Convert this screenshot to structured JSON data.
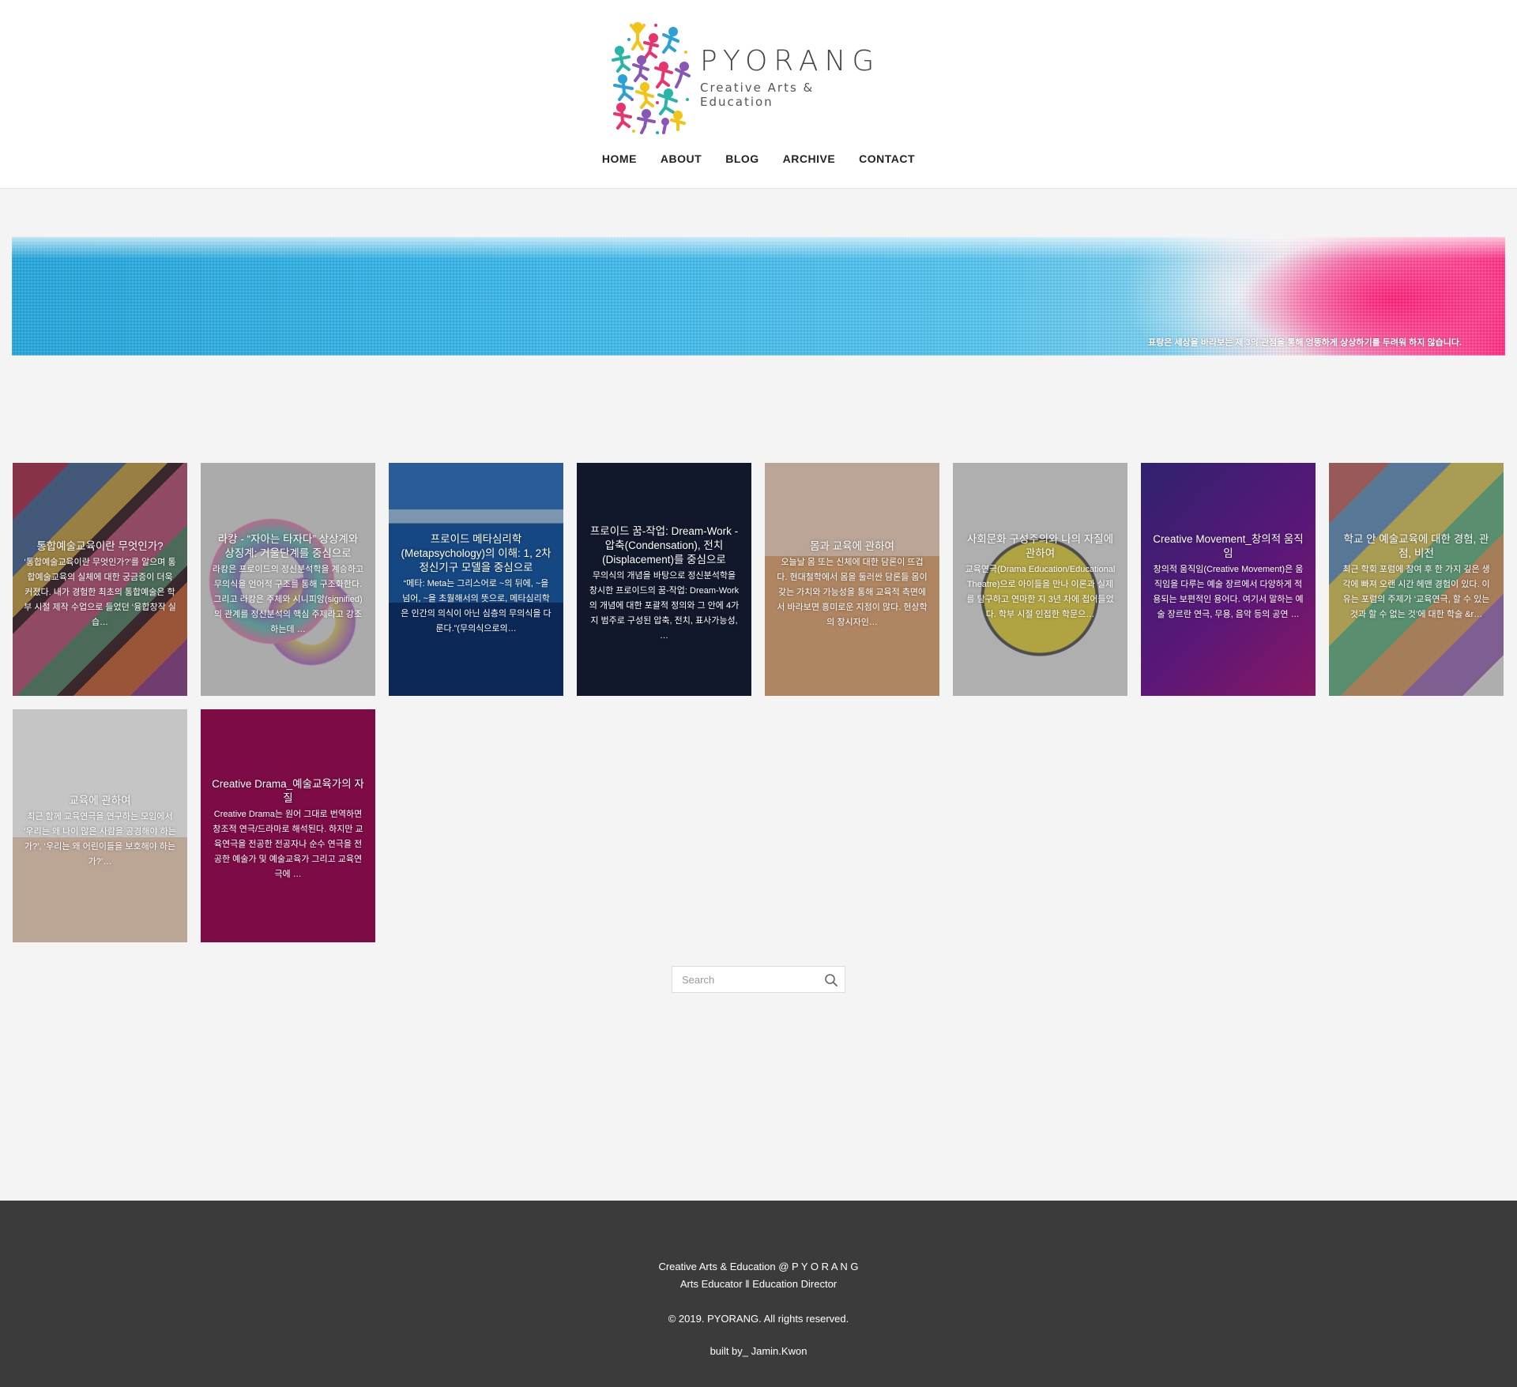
{
  "header": {
    "logo_name": "PYORANG",
    "logo_subtitle": "Creative Arts & Education",
    "nav": [
      "HOME",
      "ABOUT",
      "BLOG",
      "ARCHIVE",
      "CONTACT"
    ]
  },
  "banner": {
    "caption": "표랑은 세상을 바라보는 제 3의 관점을 통해 엉뚱하게 상상하기를 두려워 하지 않습니다."
  },
  "posts": [
    {
      "title": "통합예술교육이란 무엇인가?",
      "excerpt": "‘통합예술교육이란 무엇인가?’를 알으며 통합예술교육의 실체에 대한 궁금증이 더욱 커졌다. 내가 경험한 최초의 통합예술은 학부 시절 제작 수업으로 들었던 ‘융합창작 실습…"
    },
    {
      "title": "라캉 - “자아는 타자다” 상상계와 상징계: 거울단계를 중심으로",
      "excerpt": "라캉은 프로이드의 정신분석학을 계승하고 무의식을 언어적 구조를 통해 구조화한다. 그리고 라캉은 주체와 시니피앙(signified)의 관계를 정신분석의 핵심 주제라고 강조하는데 …"
    },
    {
      "title": "프로이드 메타심리학(Metapsychology)의 이해: 1, 2차 정신기구 모델을 중심으로",
      "excerpt": "“메타: Meta는 그리스어로 ~의 뒤에, ~을 넘어, ~을 초월해서의 뜻으로, 메타심리학은 인간의 의식이 아닌 심층의 무의식을 다룬다.”(무의식으로의…"
    },
    {
      "title": "프로이드 꿈-작업: Dream-Work - 압축(Condensation), 전치(Displacement)를 중심으로",
      "excerpt": "무의식의 개념을 바탕으로 정신분석학을 창시한 프로이드의 꿈-작업: Dream-Work의 개념에 대한 포괄적 정의와 그 안에 4가지 범주로 구성된 압축, 전치, 표사가능성, …"
    },
    {
      "title": "몸과 교육에 관하여",
      "excerpt": "오늘날 몸 또는 신체에 대한 담론이 뜨겁다. 현대철학에서 몸을 둘러싼 담론들 몸이 갖는 가치와 가능성을 통해 교육적 측면에서 바라보면 흥미로운 지점이 많다. 현상학의 창시자인…"
    },
    {
      "title": "사회문화 구성주의와 나의 자질에 관하여",
      "excerpt": "교육연극(Drama Education/Educational Theatre)으로 아이들을 만나 이론과 실제를 탐구하고 연마한 지 3년 차에 접어들었다. 학부 시절 인접한 학문으…"
    },
    {
      "title": "Creative Movement_창의적 움직임",
      "excerpt": "창의적 움직임(Creative Movement)은 움직임을 다루는 예술 장르에서 다양하게 적용되는 보편적인 용어다. 여기서 말하는 예술 장르란 연극, 무용, 음악 등의 공연 …"
    },
    {
      "title": "학교 안 예술교육에 대한 경험, 관점, 비전",
      "excerpt": "최근 학회 포럼에 참여 후 한 가지 깊은 생각에 빠져 오랜 시간 헤맨 경험이 있다. 이유는 포럼의 주제가 ‘교육연극, 할 수 있는 것과 할 수 없는 것’에 대한 학술 &r…"
    },
    {
      "title": "교육에 관하여",
      "excerpt": "최근 함께 교육연극을 연구하는 모임에서 ‘우리는 왜 나이 많은 사람을 공경해야 하는가?’, ‘우리는 왜 어린이들을 보호해야 하는가?’…"
    },
    {
      "title": "Creative Drama_예술교육가의 자질",
      "excerpt": "Creative Drama는 원어 그대로 번역하면 창조적 연극/드라마로 해석된다. 하지만 교육연극을 전공한 전공자나 순수 연극을 전공한 예술가 및 예술교육가 그리고 교육연극에 …"
    }
  ],
  "search": {
    "placeholder": "Search"
  },
  "footer": {
    "line1": "Creative Arts & Education @ P Y O R A N G",
    "line2": "Arts Educator  ‖  Education Director",
    "line3": "© 2019. PYORANG. All rights reserved.",
    "line4": "built by_ Jamin.Kwon"
  },
  "colors": {
    "header_bg": "#ffffff",
    "page_bg": "#f4f4f4",
    "footer_bg": "#3b3b3b",
    "drama_card": "#7d0b45"
  }
}
